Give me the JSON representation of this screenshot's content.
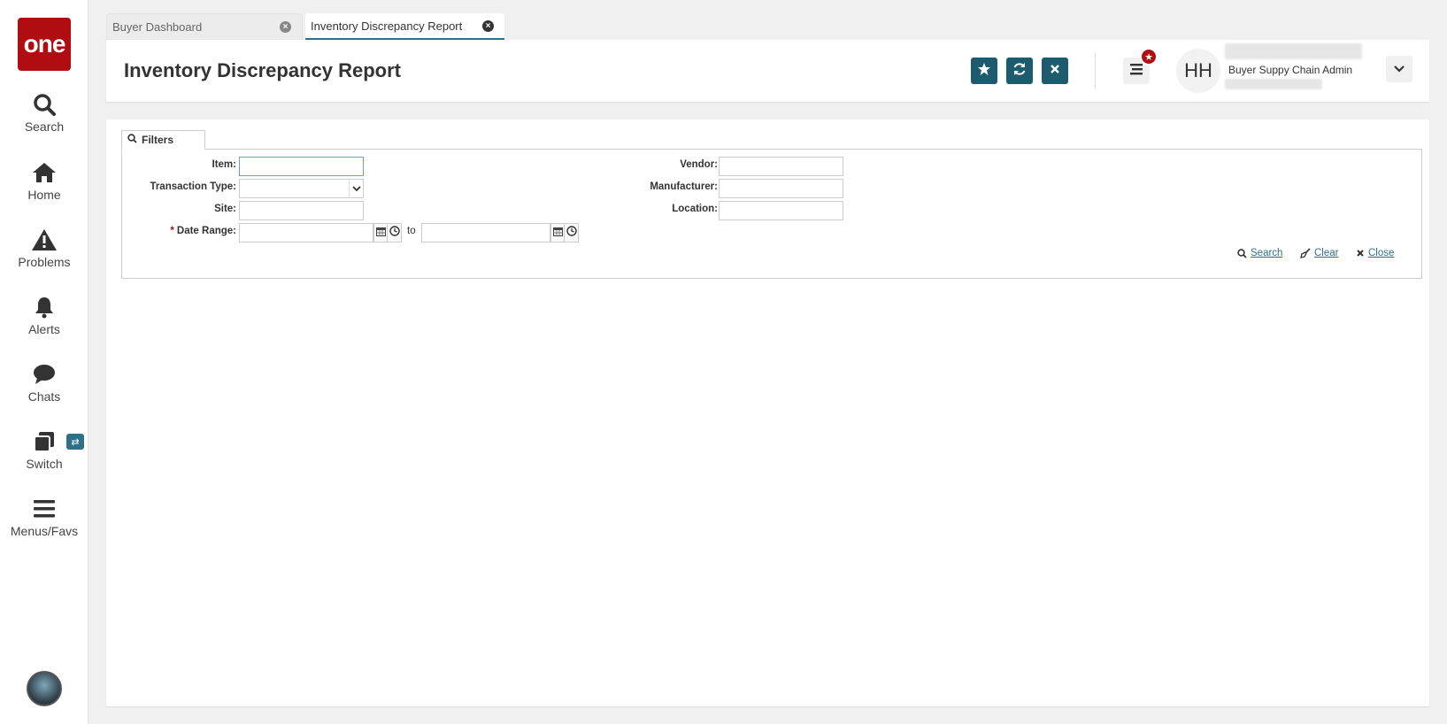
{
  "sidebar": {
    "logo": "one",
    "items": [
      {
        "label": "Search",
        "icon": "search-icon"
      },
      {
        "label": "Home",
        "icon": "home-icon"
      },
      {
        "label": "Problems",
        "icon": "warning-icon"
      },
      {
        "label": "Alerts",
        "icon": "bell-icon"
      },
      {
        "label": "Chats",
        "icon": "chat-icon"
      },
      {
        "label": "Switch",
        "icon": "switch-icon"
      },
      {
        "label": "Menus/Favs",
        "icon": "menu-icon"
      }
    ]
  },
  "tabs": [
    {
      "label": "Buyer Dashboard",
      "active": false
    },
    {
      "label": "Inventory Discrepancy Report",
      "active": true
    }
  ],
  "header": {
    "title": "Inventory Discrepancy Report",
    "user_initials": "HH",
    "user_role": "Buyer Suppy Chain Admin"
  },
  "filters": {
    "tab_label": "Filters",
    "item_label": "Item:",
    "item_value": "",
    "transaction_type_label": "Transaction Type:",
    "transaction_type_value": "",
    "site_label": "Site:",
    "site_value": "",
    "date_range_label": "Date Range:",
    "date_range_required": "*",
    "date_from": "",
    "date_to": "",
    "to_label": "to",
    "vendor_label": "Vendor:",
    "vendor_value": "",
    "manufacturer_label": "Manufacturer:",
    "manufacturer_value": "",
    "location_label": "Location:",
    "location_value": "",
    "search_link": "Search",
    "clear_link": "Clear",
    "close_link": "Close"
  },
  "colors": {
    "brand_red": "#b00d12",
    "accent_teal": "#1d5c6e",
    "link_blue": "#2f6f8a"
  }
}
